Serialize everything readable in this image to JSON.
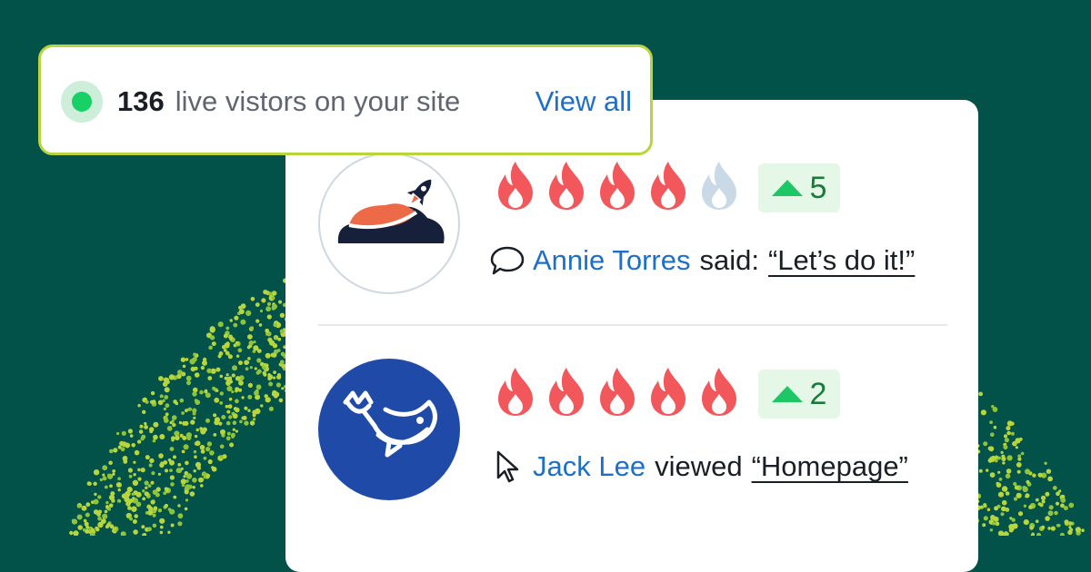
{
  "live_banner": {
    "count": "136",
    "label": "live vistors on your site",
    "link": "View all",
    "status_color": "#18d166"
  },
  "activity_feed": [
    {
      "avatar_icon": "rocket-cloud-logo-icon",
      "rating": {
        "filled": 4,
        "total": 5
      },
      "trend": {
        "direction": "up",
        "value": "5"
      },
      "action_icon": "chat-bubble-icon",
      "user": "Annie Torres",
      "verb": "said:",
      "object": "“Let’s do it!”"
    },
    {
      "avatar_icon": "whale-logo-icon",
      "rating": {
        "filled": 5,
        "total": 5
      },
      "trend": {
        "direction": "up",
        "value": "2"
      },
      "action_icon": "cursor-pointer-icon",
      "user": "Jack Lee",
      "verb": "viewed",
      "object": "“Homepage”"
    }
  ],
  "colors": {
    "background": "#03524a",
    "accent_lime": "#b8d63c",
    "flame_active": "#f2585b",
    "flame_inactive": "#c9d9e6",
    "link_blue": "#1e6fc8",
    "trend_green": "#1ec765"
  }
}
